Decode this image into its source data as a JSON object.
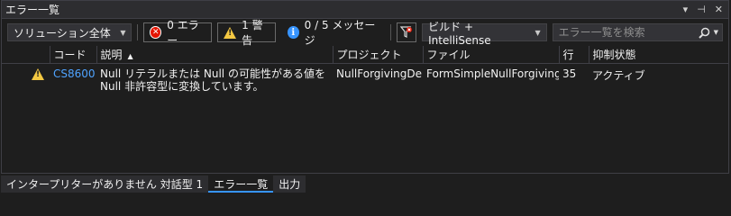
{
  "window": {
    "title": "エラー一覧"
  },
  "toolbar": {
    "scope": "ソリューション全体",
    "errors_label": "0 エラー",
    "warnings_label": "1 警告",
    "messages_label": "0 / 5 メッセージ",
    "build_filter": "ビルド + IntelliSense",
    "search_placeholder": "エラー一覧を検索"
  },
  "columns": [
    "コード",
    "説明",
    "プロジェクト",
    "ファイル",
    "行",
    "抑制状態"
  ],
  "rows": [
    {
      "severity": "warning",
      "code": "CS8600",
      "description": "Null リテラルまたは Null の可能性がある値を Null 非許容型に変換しています。",
      "project": "NullForgivingDe...",
      "file": "FormSimpleNullForgiving.cs",
      "line": "35",
      "suppression": "アクティブ"
    }
  ],
  "bottom_tabs": [
    "インタープリターがありません 対話型 1",
    "エラー一覧",
    "出力"
  ],
  "colors": {
    "accent": "#3794ff",
    "error": "#e51400",
    "warning": "#f4c842",
    "code_link": "#4fa3ff"
  }
}
